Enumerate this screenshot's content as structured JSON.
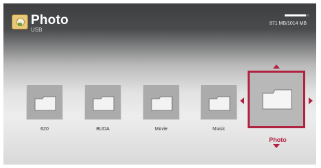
{
  "header": {
    "title": "Photo",
    "subtitle": "USB",
    "icon": "photo-icon",
    "capacity": {
      "text": "871 MB/1014 MB",
      "used_fraction": 0.86
    }
  },
  "folders": [
    {
      "label": "620",
      "icon": "folder-icon"
    },
    {
      "label": "BUDA",
      "icon": "folder-icon"
    },
    {
      "label": "Movie",
      "icon": "folder-icon"
    },
    {
      "label": "Music",
      "icon": "folder-icon"
    },
    {
      "label": "Photo",
      "icon": "folder-icon",
      "selected": true
    }
  ],
  "colors": {
    "accent": "#b0223f",
    "tile": "#ababab",
    "folder_face": "#efefef"
  }
}
